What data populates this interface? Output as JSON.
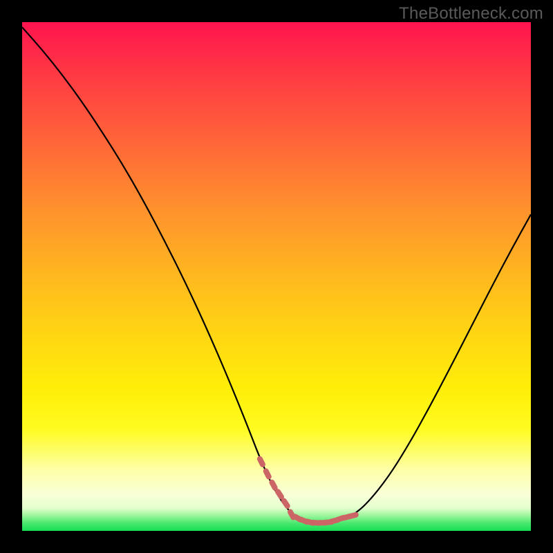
{
  "watermark": "TheBottleneck.com",
  "chart_data": {
    "type": "line",
    "title": "",
    "xlabel": "",
    "ylabel": "",
    "xlim": [
      0,
      100
    ],
    "ylim": [
      0,
      100
    ],
    "curve": {
      "x": [
        0,
        4,
        8,
        12,
        16,
        20,
        24,
        28,
        32,
        36,
        40,
        44,
        47,
        50,
        53,
        56,
        59,
        62,
        65,
        68,
        72,
        76,
        80,
        84,
        88,
        92,
        96,
        100
      ],
      "y": [
        99,
        94.5,
        89.5,
        84,
        78,
        71.6,
        64.6,
        57,
        49,
        40.4,
        31.2,
        21.4,
        13.6,
        7.2,
        3.2,
        1.8,
        1.6,
        1.8,
        3.0,
        5.6,
        10.6,
        17,
        24.2,
        31.8,
        39.6,
        47.4,
        55,
        62.2
      ]
    },
    "valley_marker": {
      "color": "#cc6666",
      "x": [
        47,
        48.2,
        49.4,
        50.6,
        51.8,
        53,
        54.2,
        55.4,
        56.6,
        57.8,
        59,
        60.2,
        61.4,
        62.6,
        63.8,
        65
      ],
      "y": [
        13.6,
        11.2,
        9.0,
        7.2,
        5.4,
        3.2,
        2.5,
        2.0,
        1.7,
        1.6,
        1.6,
        1.7,
        2.0,
        2.4,
        2.7,
        3.0
      ]
    },
    "gradient_stops": [
      {
        "pos": 0,
        "color": "#ff144e"
      },
      {
        "pos": 0.5,
        "color": "#ffb81f"
      },
      {
        "pos": 0.8,
        "color": "#fffb20"
      },
      {
        "pos": 0.97,
        "color": "#9cf59b"
      },
      {
        "pos": 1.0,
        "color": "#17de55"
      }
    ]
  }
}
